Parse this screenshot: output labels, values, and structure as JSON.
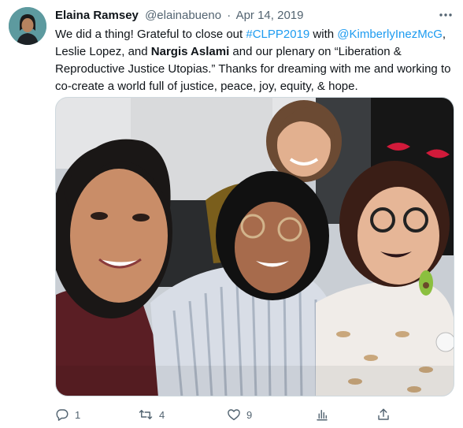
{
  "tweet": {
    "author": {
      "display_name": "Elaina Ramsey",
      "handle": "@elainabueno",
      "separator": "·",
      "date": "Apr 14, 2019"
    },
    "text": {
      "t1": "We did a thing! Grateful to close out ",
      "hashtag": "#CLPP2019",
      "t2": " with ",
      "mention": "@KimberlyInezMcG",
      "t3": ", Leslie Lopez, and ",
      "bold_name": "Nargis Aslami",
      "t4": " and our plenary on “Liberation & Reproductive Justice Utopias.” Thanks for dreaming with me and working to co-create a world full of justice, peace, joy, equity, & hope."
    },
    "actions": {
      "reply": {
        "icon": "reply-icon",
        "count": "1"
      },
      "retweet": {
        "icon": "retweet-icon",
        "count": "4"
      },
      "like": {
        "icon": "heart-icon",
        "count": "9"
      },
      "views": {
        "icon": "analytics-icon"
      },
      "share": {
        "icon": "share-icon"
      }
    }
  },
  "colors": {
    "link": "#1d9bf0",
    "secondary_text": "#536471",
    "primary_text": "#0f1419"
  }
}
